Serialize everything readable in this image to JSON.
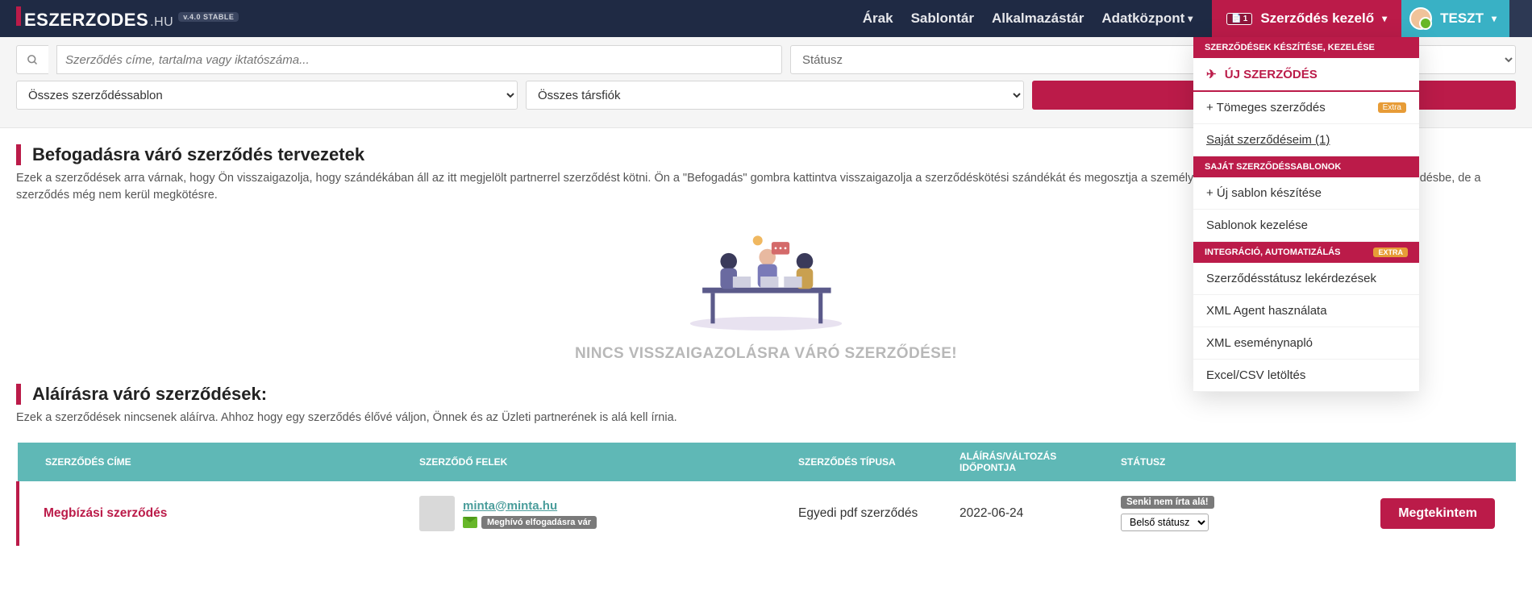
{
  "header": {
    "logo_main": "ESZERZODES",
    "logo_hu": ".HU",
    "logo_badge": "v.4.0 STABLE",
    "nav": {
      "arak": "Árak",
      "sablontar": "Sablontár",
      "alkalmazastar": "Alkalmazástár",
      "adatkozpont": "Adatközpont"
    },
    "contract_badge": "1",
    "contract_label": "Szerződés kezelő",
    "user_label": "TESZT"
  },
  "menu": {
    "sec1_title": "SZERZŐDÉSEK KÉSZÍTÉSE, KEZELÉSE",
    "new_contract": "ÚJ SZERZŐDÉS",
    "bulk_contract": "+ Tömeges szerződés",
    "bulk_extra": "Extra",
    "own_contracts": "Saját szerződéseim (1)",
    "sec2_title": "SAJÁT SZERZŐDÉSSABLONOK",
    "new_template": "+ Új sablon készítése",
    "manage_templates": "Sablonok kezelése",
    "sec3_title": "INTEGRÁCIÓ, AUTOMATIZÁLÁS",
    "sec3_extra": "EXTRA",
    "status_query": "Szerződésstátusz lekérdezések",
    "xml_agent": "XML Agent használata",
    "xml_log": "XML eseménynapló",
    "excel_dl": "Excel/CSV letöltés"
  },
  "filters": {
    "search_placeholder": "Szerződés címe, tartalma vagy iktatószáma...",
    "status_placeholder": "Státusz",
    "template_placeholder": "Összes szerződéssablon",
    "account_placeholder": "Összes társfiók"
  },
  "section1": {
    "title": "Befogadásra váró szerződés tervezetek",
    "desc": "Ezek a szerződések arra várnak, hogy Ön visszaigazolja, hogy szándékában áll az itt megjelölt partnerrel szerződést kötni. Ön a \"Befogadás\" gombra kattintva visszaigazolja a szerződéskötési szándékát és megosztja a személyes adatait. Ezek bekerülnek az adott szerződésbe, de a szerződés még nem kerül megkötésre.",
    "empty": "NINCS VISSZAIGAZOLÁSRA VÁRÓ SZERZŐDÉSE!"
  },
  "section2": {
    "title": "Aláírásra váró szerződések:",
    "desc": "Ezek a szerződések nincsenek aláírva. Ahhoz hogy egy szerződés élővé váljon, Önnek és az Üzleti partnerének is alá kell írnia."
  },
  "table": {
    "headers": {
      "title": "SZERZŐDÉS CÍME",
      "parties": "SZERZŐDŐ FELEK",
      "type": "SZERZŐDÉS TÍPUSA",
      "date": "ALÁÍRÁS/VÁLTOZÁS IDŐPONTJA",
      "status": "STÁTUSZ"
    },
    "rows": [
      {
        "title": "Megbízási szerződés",
        "party_email": "minta@minta.hu",
        "party_badge": "Meghívó elfogadásra vár",
        "type": "Egyedi pdf szerződés",
        "date": "2022-06-24",
        "status_badge": "Senki nem írta alá!",
        "status_select": "Belső státusz",
        "view_btn": "Megtekintem"
      }
    ]
  }
}
